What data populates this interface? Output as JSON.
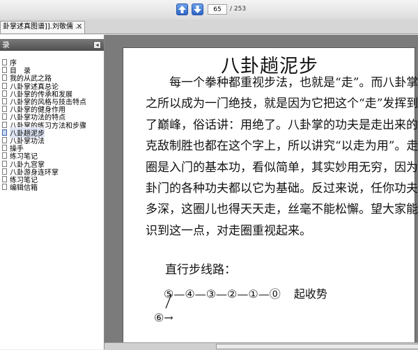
{
  "toolbar": {
    "page_current": "65",
    "page_total": "/ 253",
    "up_icon": "arrow-up-icon",
    "down_icon": "arrow-down-icon"
  },
  "tab": {
    "label": "卦掌述真图谱]].刘敬儒 ...",
    "close": "✕"
  },
  "sidebar": {
    "title": "录",
    "collapse": "◂",
    "items": [
      {
        "label": "序"
      },
      {
        "label": "目　录"
      },
      {
        "label": "我的从武之路"
      },
      {
        "label": "八卦掌述真总论"
      },
      {
        "label": "八卦掌的传承和发展"
      },
      {
        "label": "八卦掌的风格与技击特点"
      },
      {
        "label": "八卦掌的健身作用"
      },
      {
        "label": "八卦掌功法的特点"
      },
      {
        "label": "八卦掌的练习方法和步骤"
      },
      {
        "label": "八卦趟泥步"
      },
      {
        "label": "八卦掌功法"
      },
      {
        "label": "操手"
      },
      {
        "label": "练习笔记"
      },
      {
        "label": "八卦九宫掌"
      },
      {
        "label": "八卦游身连环掌"
      },
      {
        "label": "练习笔记"
      },
      {
        "label": "编辑信箱"
      }
    ]
  },
  "document": {
    "title": "八卦趟泥步",
    "paragraph": "每一个拳种都重视步法，也就是“走”。而八卦掌之所以成为一门绝技，就是因为它把这个“走”发挥到了巅峰，俗话讲：用绝了。八卦掌的功夫是走出来的，克敌制胜也都在这个字上，所以讲究“以走为用”。走圈是入门的基本功，看似简单，其实妙用无穷，因为八卦门的各种功夫都以它为基础。反过来说，任你功夫有多深，这圈儿也得天天走，丝毫不能松懈。望大家能认识到这一点，对走圈重视起来。",
    "route_label": "直行步线路：",
    "route_sequence": "⑤—④—③—②—①—⓪",
    "route_end": "起收势",
    "route_six": "⑥→"
  }
}
